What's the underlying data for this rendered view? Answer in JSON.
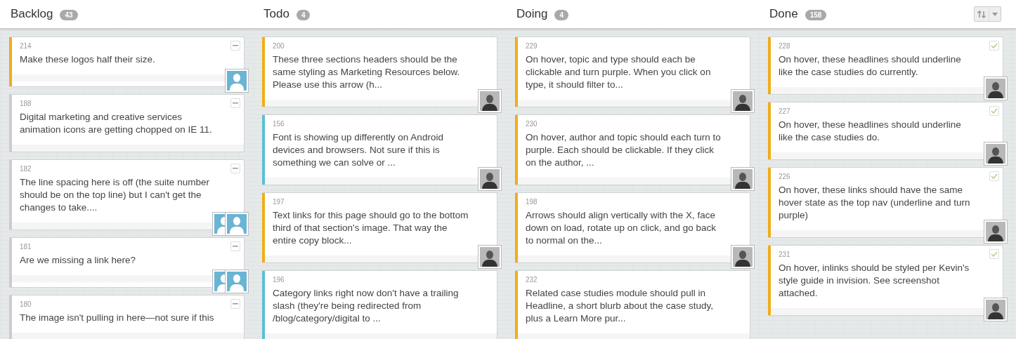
{
  "columns": [
    {
      "title": "Backlog",
      "count": "43",
      "cards": [
        {
          "number": "214",
          "text": "Make these logos half their size.",
          "color": "#f0ad1a",
          "kind": "collapsible",
          "avatars": [
            {
              "kind": "placeholder"
            }
          ]
        },
        {
          "number": "188",
          "text": "Digital marketing and creative services animation icons are getting chopped on IE 11.",
          "color": "#cccccc",
          "kind": "collapsible"
        },
        {
          "number": "182",
          "text": "The line spacing here is off (the suite number should be on the top line) but I can't get the changes to take....",
          "color": "#cccccc",
          "kind": "collapsible",
          "avatars": [
            {
              "kind": "placeholder"
            },
            {
              "kind": "placeholder"
            }
          ]
        },
        {
          "number": "181",
          "text": "Are we missing a link here?",
          "color": "#cccccc",
          "kind": "collapsible",
          "avatars": [
            {
              "kind": "placeholder"
            },
            {
              "kind": "placeholder"
            }
          ]
        },
        {
          "number": "180",
          "text": "The image isn't pulling in here—not sure if this",
          "color": "#cccccc",
          "kind": "collapsible"
        }
      ]
    },
    {
      "title": "Todo",
      "count": "4",
      "cards": [
        {
          "number": "200",
          "text": "These three sections headers should be the same styling as Marketing Resources below. Please use this arrow (h...",
          "color": "#f0ad1a",
          "kind": "plain",
          "avatars": [
            {
              "kind": "photo"
            }
          ]
        },
        {
          "number": "156",
          "text": "Font is showing up differently on Android devices and browsers. Not sure if this is something we can solve or ...",
          "color": "#5bc0d3",
          "kind": "plain",
          "avatars": [
            {
              "kind": "photo"
            }
          ]
        },
        {
          "number": "197",
          "text": "Text links for this page should go to the bottom third of that section's image. That way the entire copy block...",
          "color": "#f0ad1a",
          "kind": "plain",
          "avatars": [
            {
              "kind": "photo"
            }
          ]
        },
        {
          "number": "196",
          "text": "Category links right now don't have a trailing slash (they're being redirected from /blog/category/digital to ...",
          "color": "#5bc0d3",
          "kind": "plain"
        }
      ]
    },
    {
      "title": "Doing",
      "count": "4",
      "cards": [
        {
          "number": "229",
          "text": "On hover, topic and type should each be clickable and turn purple. When you click on type, it should filter to...",
          "color": "#f0ad1a",
          "kind": "plain",
          "avatars": [
            {
              "kind": "photo"
            }
          ]
        },
        {
          "number": "230",
          "text": "On hover, author and topic should each turn to purple. Each should be clickable. If they click on the author, ...",
          "color": "#f0ad1a",
          "kind": "plain",
          "avatars": [
            {
              "kind": "photo"
            }
          ]
        },
        {
          "number": "198",
          "text": "Arrows should align vertically with the X, face down on load, rotate up on click, and go back to normal on the...",
          "color": "#f0ad1a",
          "kind": "plain",
          "avatars": [
            {
              "kind": "photo"
            }
          ]
        },
        {
          "number": "232",
          "text": "Related case studies module should pull in Headline, a short blurb about the case study, plus a Learn More pur...",
          "color": "#f0ad1a",
          "kind": "plain"
        }
      ]
    },
    {
      "title": "Done",
      "count": "158",
      "cards": [
        {
          "number": "228",
          "text": "On hover, these headlines should underline like the case studies do currently.",
          "color": "#f0ad1a",
          "kind": "checkable",
          "checked": true,
          "avatars": [
            {
              "kind": "photo"
            }
          ]
        },
        {
          "number": "227",
          "text": "On hover, these headlines should underline like the case studies do.",
          "color": "#f0ad1a",
          "kind": "checkable",
          "checked": true,
          "avatars": [
            {
              "kind": "photo"
            }
          ]
        },
        {
          "number": "226",
          "text": "On hover, these links should have the same hover state as the top nav (underline and turn purple)",
          "color": "#f0ad1a",
          "kind": "checkable",
          "checked": true,
          "avatars": [
            {
              "kind": "photo"
            }
          ]
        },
        {
          "number": "231",
          "text": "On hover, inlinks should be styled per Kevin's style guide in invision. See screenshot attached.",
          "color": "#f0ad1a",
          "kind": "checkable",
          "checked": true,
          "avatars": [
            {
              "kind": "photo"
            }
          ]
        }
      ]
    }
  ]
}
